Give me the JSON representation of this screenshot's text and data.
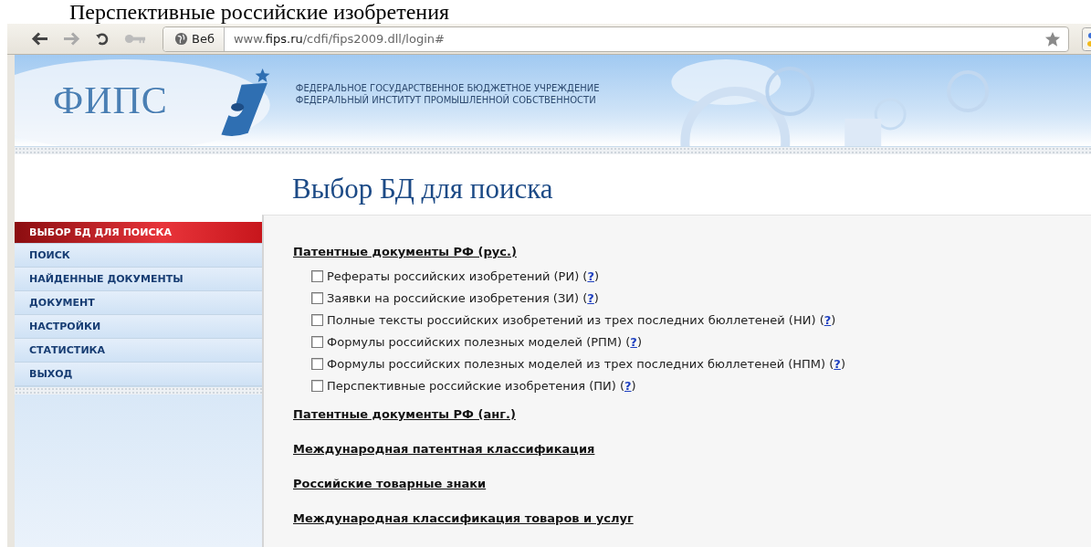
{
  "caption": "Перспективные российские изобретения",
  "browser": {
    "chip": "Веб",
    "url": "www.**fips.ru**/cdfi/fips2009.dll/login#"
  },
  "header": {
    "logo": "ФИПС",
    "lines": [
      "ФЕДЕРАЛЬНОЕ ГОСУДАРСТВЕННОЕ БЮДЖЕТНОЕ УЧРЕЖДЕНИЕ",
      "ФЕДЕРАЛЬНЫЙ ИНСТИТУТ ПРОМЫШЛЕННОЙ СОБСТВЕННОСТИ"
    ]
  },
  "page_title": "Выбор БД для поиска",
  "sidebar": {
    "items": [
      {
        "label": "ВЫБОР БД ДЛЯ ПОИСКА",
        "selected": true
      },
      {
        "label": "ПОИСК",
        "selected": false
      },
      {
        "label": "НАЙДЕННЫЕ ДОКУМЕНТЫ",
        "selected": false
      },
      {
        "label": "ДОКУМЕНТ",
        "selected": false
      },
      {
        "label": "НАСТРОЙКИ",
        "selected": false
      },
      {
        "label": "СТАТИСТИКА",
        "selected": false
      },
      {
        "label": "ВЫХОД",
        "selected": false
      }
    ]
  },
  "sections": [
    {
      "title": "Патентные документы РФ (рус.)",
      "databases": [
        {
          "label": "Рефераты российских изобретений (РИ) (",
          "help": "?",
          "tail": ")",
          "checked": false
        },
        {
          "label": "Заявки на российские изобретения (ЗИ) (",
          "help": "?",
          "tail": ")",
          "checked": false
        },
        {
          "label": "Полные тексты российских изобретений из трех последних бюллетеней (НИ) (",
          "help": "?",
          "tail": ")",
          "checked": false
        },
        {
          "label": "Формулы российских полезных моделей (РПМ) (",
          "help": "?",
          "tail": ")",
          "checked": false
        },
        {
          "label": "Формулы российских полезных моделей из трех последних бюллетеней (НПМ) (",
          "help": "?",
          "tail": ")",
          "checked": false
        },
        {
          "label": "Перспективные российские изобретения (ПИ) (",
          "help": "?",
          "tail": ")",
          "checked": false
        }
      ]
    },
    {
      "title": "Патентные документы РФ (анг.)"
    },
    {
      "title": "Международная патентная классификация"
    },
    {
      "title": "Российские товарные знаки"
    },
    {
      "title": "Международная классификация товаров и услуг"
    }
  ]
}
